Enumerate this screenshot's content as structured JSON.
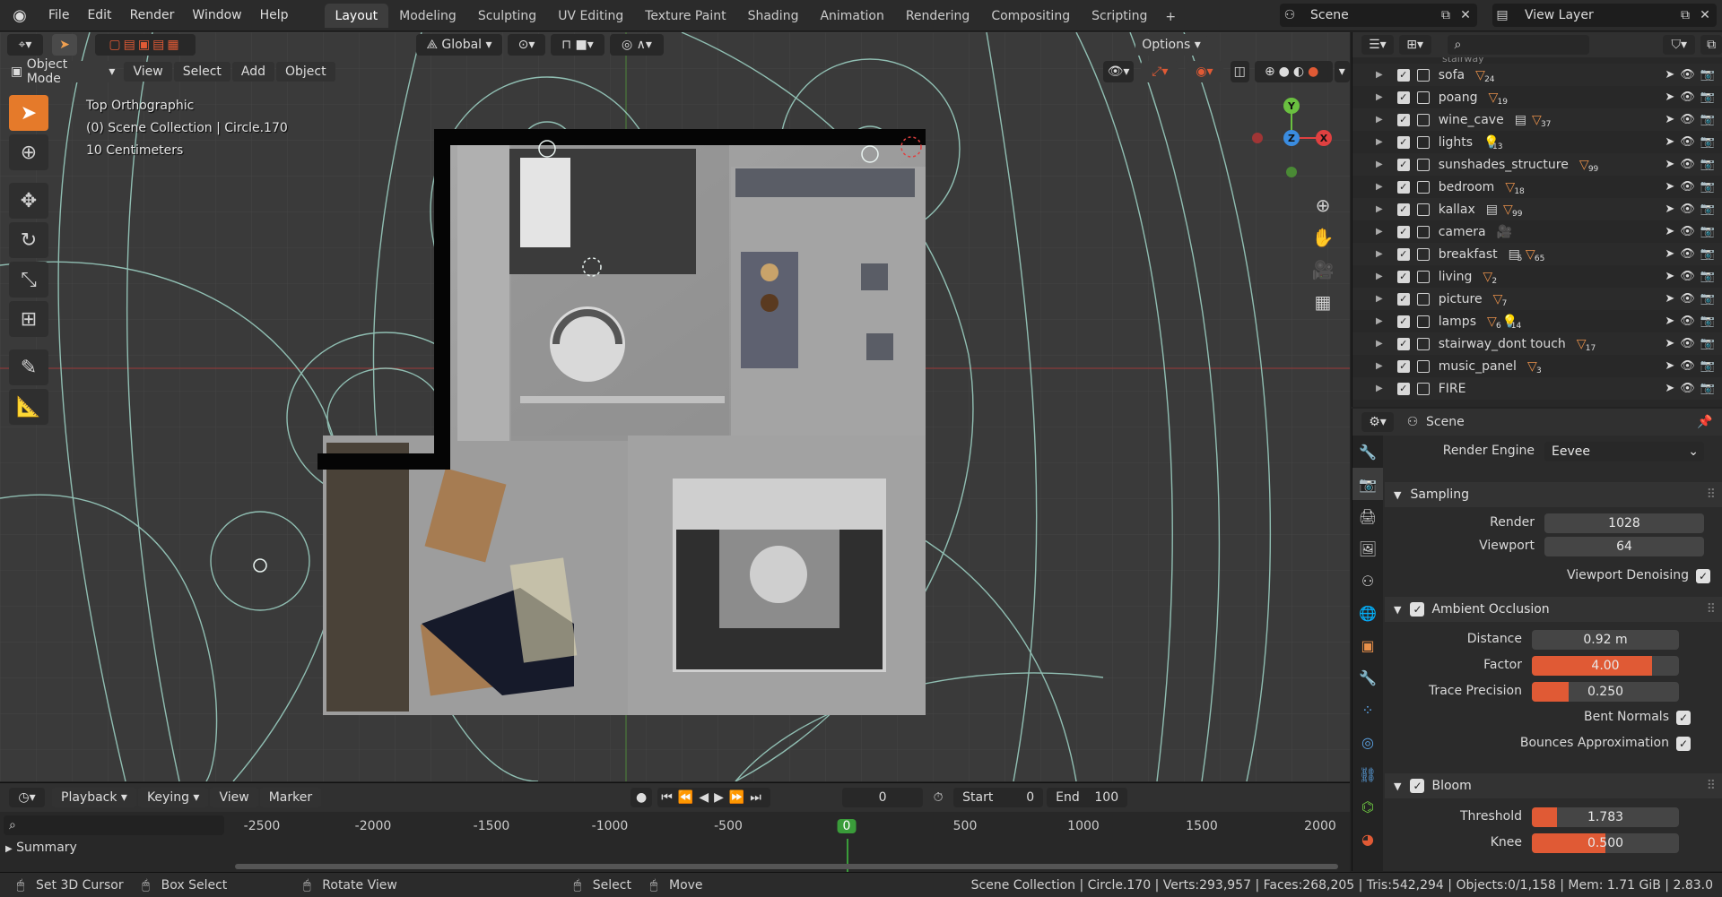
{
  "menubar": {
    "items": [
      "File",
      "Edit",
      "Render",
      "Window",
      "Help"
    ]
  },
  "workspaces": {
    "tabs": [
      "Layout",
      "Modeling",
      "Sculpting",
      "UV Editing",
      "Texture Paint",
      "Shading",
      "Animation",
      "Rendering",
      "Compositing",
      "Scripting"
    ],
    "active": "Layout",
    "add_label": "+"
  },
  "scene": {
    "name": "Scene"
  },
  "view_layer": {
    "name": "View Layer"
  },
  "viewport": {
    "transform_orientation": "Global",
    "options_label": "Options",
    "mode": "Object Mode",
    "menus": [
      "View",
      "Select",
      "Add",
      "Object"
    ],
    "overlay_lines": [
      "Top Orthographic",
      "(0) Scene Collection | Circle.170",
      "10 Centimeters"
    ],
    "gizmo": {
      "y": "Y",
      "x": "X",
      "z": "Z"
    }
  },
  "outliner": {
    "search_placeholder": "",
    "partial_top": "stairway",
    "rows": [
      {
        "name": "sofa",
        "badges": [
          {
            "icon": "mesh",
            "count": "24"
          }
        ]
      },
      {
        "name": "poang",
        "badges": [
          {
            "icon": "mesh",
            "count": "19"
          }
        ]
      },
      {
        "name": "wine_cave",
        "badges": [
          {
            "icon": "collection",
            "count": ""
          },
          {
            "icon": "mesh",
            "count": "37"
          }
        ]
      },
      {
        "name": "lights",
        "badges": [
          {
            "icon": "light",
            "count": "13"
          }
        ]
      },
      {
        "name": "sunshades_structure",
        "badges": [
          {
            "icon": "mesh",
            "count": "99"
          }
        ]
      },
      {
        "name": "bedroom",
        "badges": [
          {
            "icon": "mesh",
            "count": "18"
          }
        ]
      },
      {
        "name": "kallax",
        "badges": [
          {
            "icon": "collection",
            "count": ""
          },
          {
            "icon": "mesh",
            "count": "99"
          }
        ]
      },
      {
        "name": "camera",
        "badges": [
          {
            "icon": "camera",
            "count": ""
          }
        ]
      },
      {
        "name": "breakfast",
        "badges": [
          {
            "icon": "collection",
            "count": "5"
          },
          {
            "icon": "mesh",
            "count": "65"
          }
        ]
      },
      {
        "name": "living",
        "badges": [
          {
            "icon": "mesh",
            "count": "2"
          }
        ]
      },
      {
        "name": "picture",
        "badges": [
          {
            "icon": "mesh",
            "count": "7"
          }
        ]
      },
      {
        "name": "lamps",
        "badges": [
          {
            "icon": "mesh",
            "count": "6"
          },
          {
            "icon": "light",
            "count": "14"
          }
        ]
      },
      {
        "name": "stairway_dont touch",
        "badges": [
          {
            "icon": "mesh",
            "count": "17"
          }
        ]
      },
      {
        "name": "music_panel",
        "badges": [
          {
            "icon": "mesh",
            "count": "3"
          }
        ]
      },
      {
        "name": "FIRE",
        "badges": []
      }
    ]
  },
  "properties": {
    "context": "Scene",
    "render_engine_label": "Render Engine",
    "render_engine": "Eevee",
    "sampling": {
      "title": "Sampling",
      "render_label": "Render",
      "render": "1028",
      "viewport_label": "Viewport",
      "viewport": "64",
      "denoise_label": "Viewport Denoising"
    },
    "ao": {
      "title": "Ambient Occlusion",
      "distance_label": "Distance",
      "distance": "0.92 m",
      "factor_label": "Factor",
      "factor": "4.00",
      "factor_fill": 0.82,
      "trace_label": "Trace Precision",
      "trace": "0.250",
      "trace_fill": 0.25,
      "bent_label": "Bent Normals",
      "bounce_label": "Bounces Approximation"
    },
    "bloom": {
      "title": "Bloom",
      "threshold_label": "Threshold",
      "threshold": "1.783",
      "threshold_fill": 0.17,
      "knee_label": "Knee",
      "knee": "0.500",
      "knee_fill": 0.5
    }
  },
  "timeline": {
    "menus": [
      "Playback",
      "Keying",
      "View",
      "Marker"
    ],
    "current_frame": "0",
    "start_label": "Start",
    "start": "0",
    "end_label": "End",
    "end": "100",
    "summary": "Summary",
    "ticks": [
      "-2500",
      "-2000",
      "-1500",
      "-1000",
      "-500",
      "0",
      "500",
      "1000",
      "1500",
      "2000"
    ]
  },
  "statusbar": {
    "hints": [
      "Set 3D Cursor",
      "Box Select",
      "Rotate View",
      "Select",
      "Move"
    ],
    "stats": "Scene Collection | Circle.170 | Verts:293,957 | Faces:268,205 | Tris:542,294 | Objects:0/1,158 | Mem: 1.71 GiB | 2.83.0"
  },
  "colors": {
    "accent": "#e57a2a",
    "slider_fill": "#e05a35",
    "x_axis": "#e04040",
    "y_axis": "#6ac040",
    "z_axis": "#3a8ce0",
    "keyframe_current": "#3a9c3a"
  }
}
